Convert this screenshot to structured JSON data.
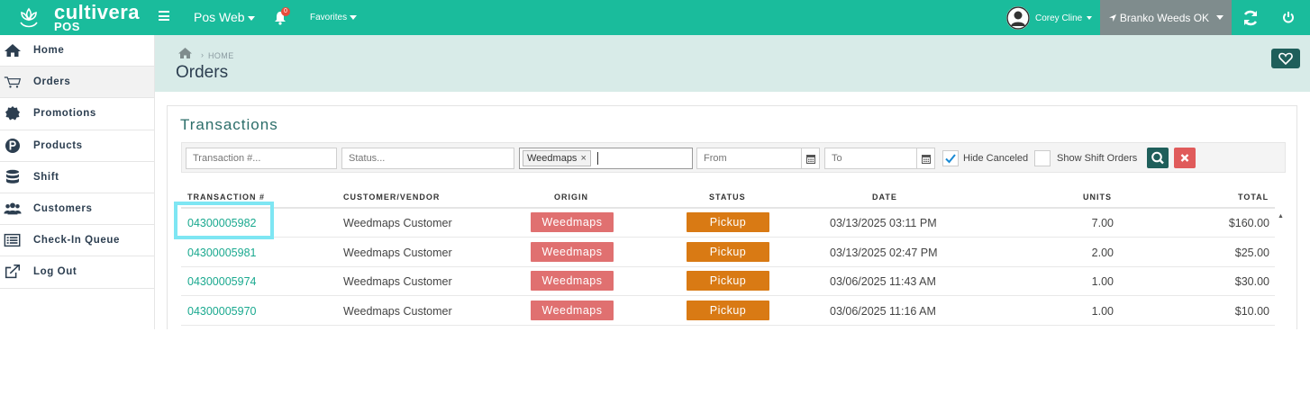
{
  "brand": {
    "name": "cultivera",
    "sub": "POS"
  },
  "topbar": {
    "app_menu_label": "Pos Web",
    "notification_count": "0",
    "favorites_label": "Favorites",
    "user_name": "Corey Cline",
    "location_name": "Branko Weeds OK"
  },
  "sidebar": {
    "items": [
      {
        "label": "Home",
        "icon": "home-icon"
      },
      {
        "label": "Orders",
        "icon": "cart-icon"
      },
      {
        "label": "Promotions",
        "icon": "badge-icon"
      },
      {
        "label": "Products",
        "icon": "product-p-icon"
      },
      {
        "label": "Shift",
        "icon": "database-icon"
      },
      {
        "label": "Customers",
        "icon": "users-icon"
      },
      {
        "label": "Check-In Queue",
        "icon": "list-icon"
      },
      {
        "label": "Log Out",
        "icon": "external-link-icon"
      }
    ],
    "active_index": 1
  },
  "breadcrumb": {
    "current": "HOME"
  },
  "page": {
    "title": "Orders"
  },
  "panel": {
    "title": "Transactions"
  },
  "filters": {
    "transaction_placeholder": "Transaction #...",
    "status_placeholder": "Status...",
    "origin_tag": "Weedmaps",
    "from_placeholder": "From",
    "to_placeholder": "To",
    "hide_canceled_label": "Hide Canceled",
    "hide_canceled_checked": true,
    "show_shift_orders_label": "Show Shift Orders",
    "show_shift_orders_checked": false
  },
  "table": {
    "headers": [
      "TRANSACTION #",
      "CUSTOMER/VENDOR",
      "ORIGIN",
      "STATUS",
      "DATE",
      "UNITS",
      "TOTAL"
    ],
    "rows": [
      {
        "transaction": "04300005982",
        "customer": "Weedmaps Customer",
        "origin": "Weedmaps",
        "status": "Pickup",
        "date": "03/13/2025 03:11 PM",
        "units": "7.00",
        "total": "$160.00"
      },
      {
        "transaction": "04300005981",
        "customer": "Weedmaps Customer",
        "origin": "Weedmaps",
        "status": "Pickup",
        "date": "03/13/2025 02:47 PM",
        "units": "2.00",
        "total": "$25.00"
      },
      {
        "transaction": "04300005974",
        "customer": "Weedmaps Customer",
        "origin": "Weedmaps",
        "status": "Pickup",
        "date": "03/06/2025 11:43 AM",
        "units": "1.00",
        "total": "$30.00"
      },
      {
        "transaction": "04300005970",
        "customer": "Weedmaps Customer",
        "origin": "Weedmaps",
        "status": "Pickup",
        "date": "03/06/2025 11:16 AM",
        "units": "1.00",
        "total": "$10.00"
      }
    ]
  },
  "colors": {
    "topbar": "#1abc9c",
    "location_bg": "#7f8c8d",
    "origin_pill": "#e07070",
    "status_pill": "#d97a14",
    "link": "#1aa98f",
    "highlight": "#7ee6f3"
  }
}
